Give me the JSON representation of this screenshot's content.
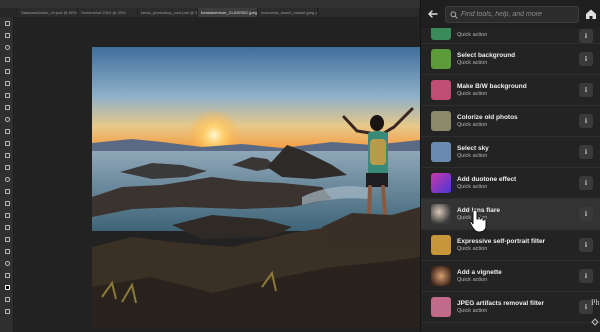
{
  "tabs": [
    {
      "label": "StandardAction_v9.psd @ 50% (RGB/8)"
    },
    {
      "label": "Screenshot 2024 @ 33%"
    },
    {
      "label": "Ideas_photoshop_cool.psd @ 33%"
    },
    {
      "label": "bestadventure_CLASSSIC.jpeg @ 66.7% (RGB/8)"
    },
    {
      "label": "Indonesia_beach_sunset.jpeg @ 33.3%"
    }
  ],
  "panel": {
    "search_placeholder": "Find tools, help, and more",
    "items": [
      {
        "title": "",
        "sub": "Quick action",
        "thumb": "#3a8a5a",
        "icon": "generic-thumb-icon"
      },
      {
        "title": "Select background",
        "sub": "Quick action",
        "thumb": "#5c9a3a",
        "icon": "select-background-icon"
      },
      {
        "title": "Make B/W background",
        "sub": "Quick action",
        "thumb": "#c14c74",
        "icon": "bw-background-icon"
      },
      {
        "title": "Colorize old photos",
        "sub": "Quick action",
        "thumb": "#8a8a6a",
        "icon": "colorize-icon"
      },
      {
        "title": "Select sky",
        "sub": "Quick action",
        "thumb": "#6a8ab0",
        "icon": "select-sky-icon"
      },
      {
        "title": "Add duotone effect",
        "sub": "Quick action",
        "thumb": "#8a38c8",
        "icon": "duotone-icon"
      },
      {
        "title": "Add lens flare",
        "sub": "Quick action",
        "thumb": "#3a3a3a",
        "icon": "lens-flare-icon"
      },
      {
        "title": "Expressive self-portrait filter",
        "sub": "Quick action",
        "thumb": "#c8963a",
        "icon": "self-portrait-icon"
      },
      {
        "title": "Add a vignette",
        "sub": "Quick action",
        "thumb": "#b05a3a",
        "icon": "vignette-icon"
      },
      {
        "title": "JPEG artifacts removal filter",
        "sub": "Quick action",
        "thumb": "#c26a8a",
        "icon": "jpeg-filter-icon"
      }
    ]
  },
  "fragment_text": "Ph",
  "colors": {
    "accent": "#3a8bff",
    "panel_bg": "#232323"
  }
}
